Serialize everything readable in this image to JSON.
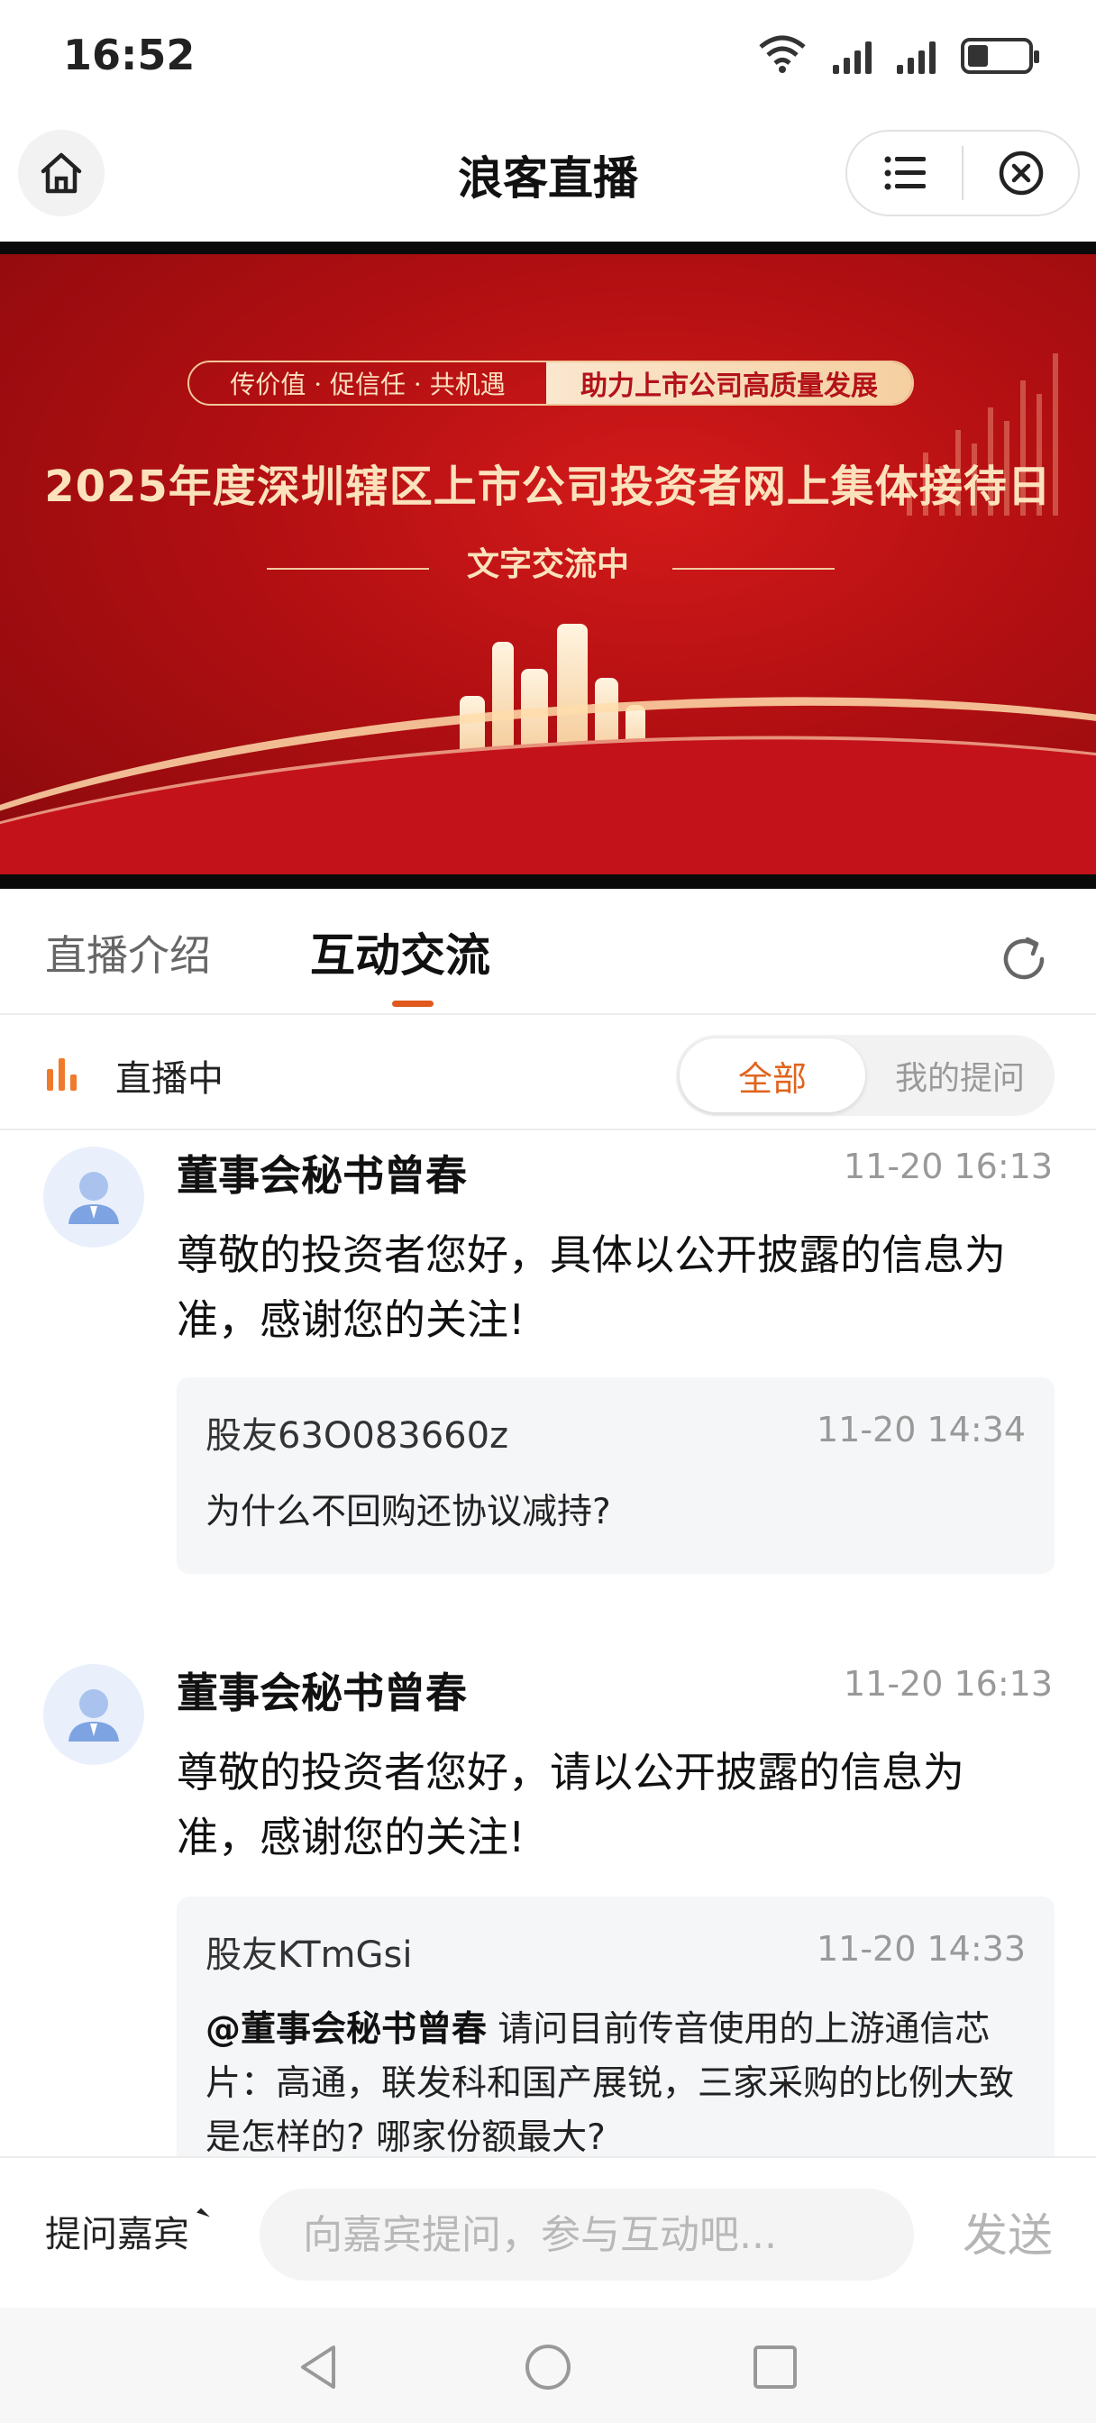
{
  "status_bar": {
    "time": "16:52",
    "icons": [
      "wifi-icon",
      "signal-icon",
      "signal-icon",
      "battery-icon"
    ]
  },
  "nav": {
    "title": "浪客直播",
    "home_icon": "home-icon",
    "menu_icon": "list-menu-icon",
    "close_icon": "close-icon"
  },
  "banner": {
    "slogan_left": "传价值 · 促信任 · 共机遇",
    "slogan_right": "助力上市公司高质量发展",
    "title": "2025年度深圳辖区上市公司投资者网上集体接待日",
    "subtitle": "文字交流中",
    "colors": {
      "background": "#b10f12",
      "gold": "#fbe2bd"
    }
  },
  "tabs": [
    {
      "label": "直播介绍",
      "active": false
    },
    {
      "label": "互动交流",
      "active": true
    }
  ],
  "filter": {
    "live_label": "直播中",
    "options": [
      "全部",
      "我的提问"
    ],
    "selected": "全部",
    "accent_color": "#e0651e"
  },
  "messages": [
    {
      "author": "董事会秘书曾春",
      "time": "11-20 16:13",
      "answer": "尊敬的投资者您好，具体以公开披露的信息为准，感谢您的关注!",
      "question": {
        "user": "股友63O083660z",
        "time": "11-20 14:34",
        "mention": "",
        "text": "为什么不回购还协议减持?"
      }
    },
    {
      "author": "董事会秘书曾春",
      "time": "11-20 16:13",
      "answer": "尊敬的投资者您好，请以公开披露的信息为准，感谢您的关注!",
      "question": {
        "user": "股友KTmGsi",
        "time": "11-20 14:33",
        "mention": "@董事会秘书曾春",
        "text": " 请问目前传音使用的上游通信芯片：高通，联发科和国产展锐，三家采购的比例大致是怎样的? 哪家份额最大?"
      }
    }
  ],
  "input_bar": {
    "ask_label": "提问嘉宾",
    "placeholder": "向嘉宾提问，参与互动吧...",
    "send_label": "发送"
  }
}
